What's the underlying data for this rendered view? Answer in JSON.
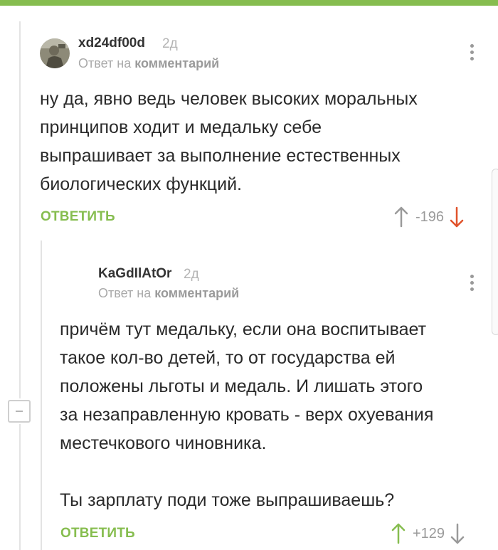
{
  "colors": {
    "accent": "#86bd4f",
    "minus": "#e0522b"
  },
  "comments": [
    {
      "username": "xd24df00d",
      "time": "2д",
      "reply_prefix": "Ответ на",
      "reply_target": "комментарий",
      "text": "ну да, явно ведь человек высоких моральных\nпринципов ходит и медальку себе\nвыпрашивает за выполнение естественных\nбиологических функций.",
      "reply_label": "ОТВЕТИТЬ",
      "rating": "-196",
      "vote": "down"
    },
    {
      "username": "KaGdIlAtOr",
      "time": "2д",
      "reply_prefix": "Ответ на",
      "reply_target": "комментарий",
      "text": "причём тут медальку, если она воспитывает\nтакое кол-во детей, то от государства ей\nположены льготы и медаль. И лишать этого\nза незаправленную кровать - верх охуевания\nместечкового чиновника.\n\nТы зарплату поди тоже выпрашиваешь?",
      "reply_label": "ОТВЕТИТЬ",
      "rating": "+129",
      "vote": "up"
    }
  ]
}
